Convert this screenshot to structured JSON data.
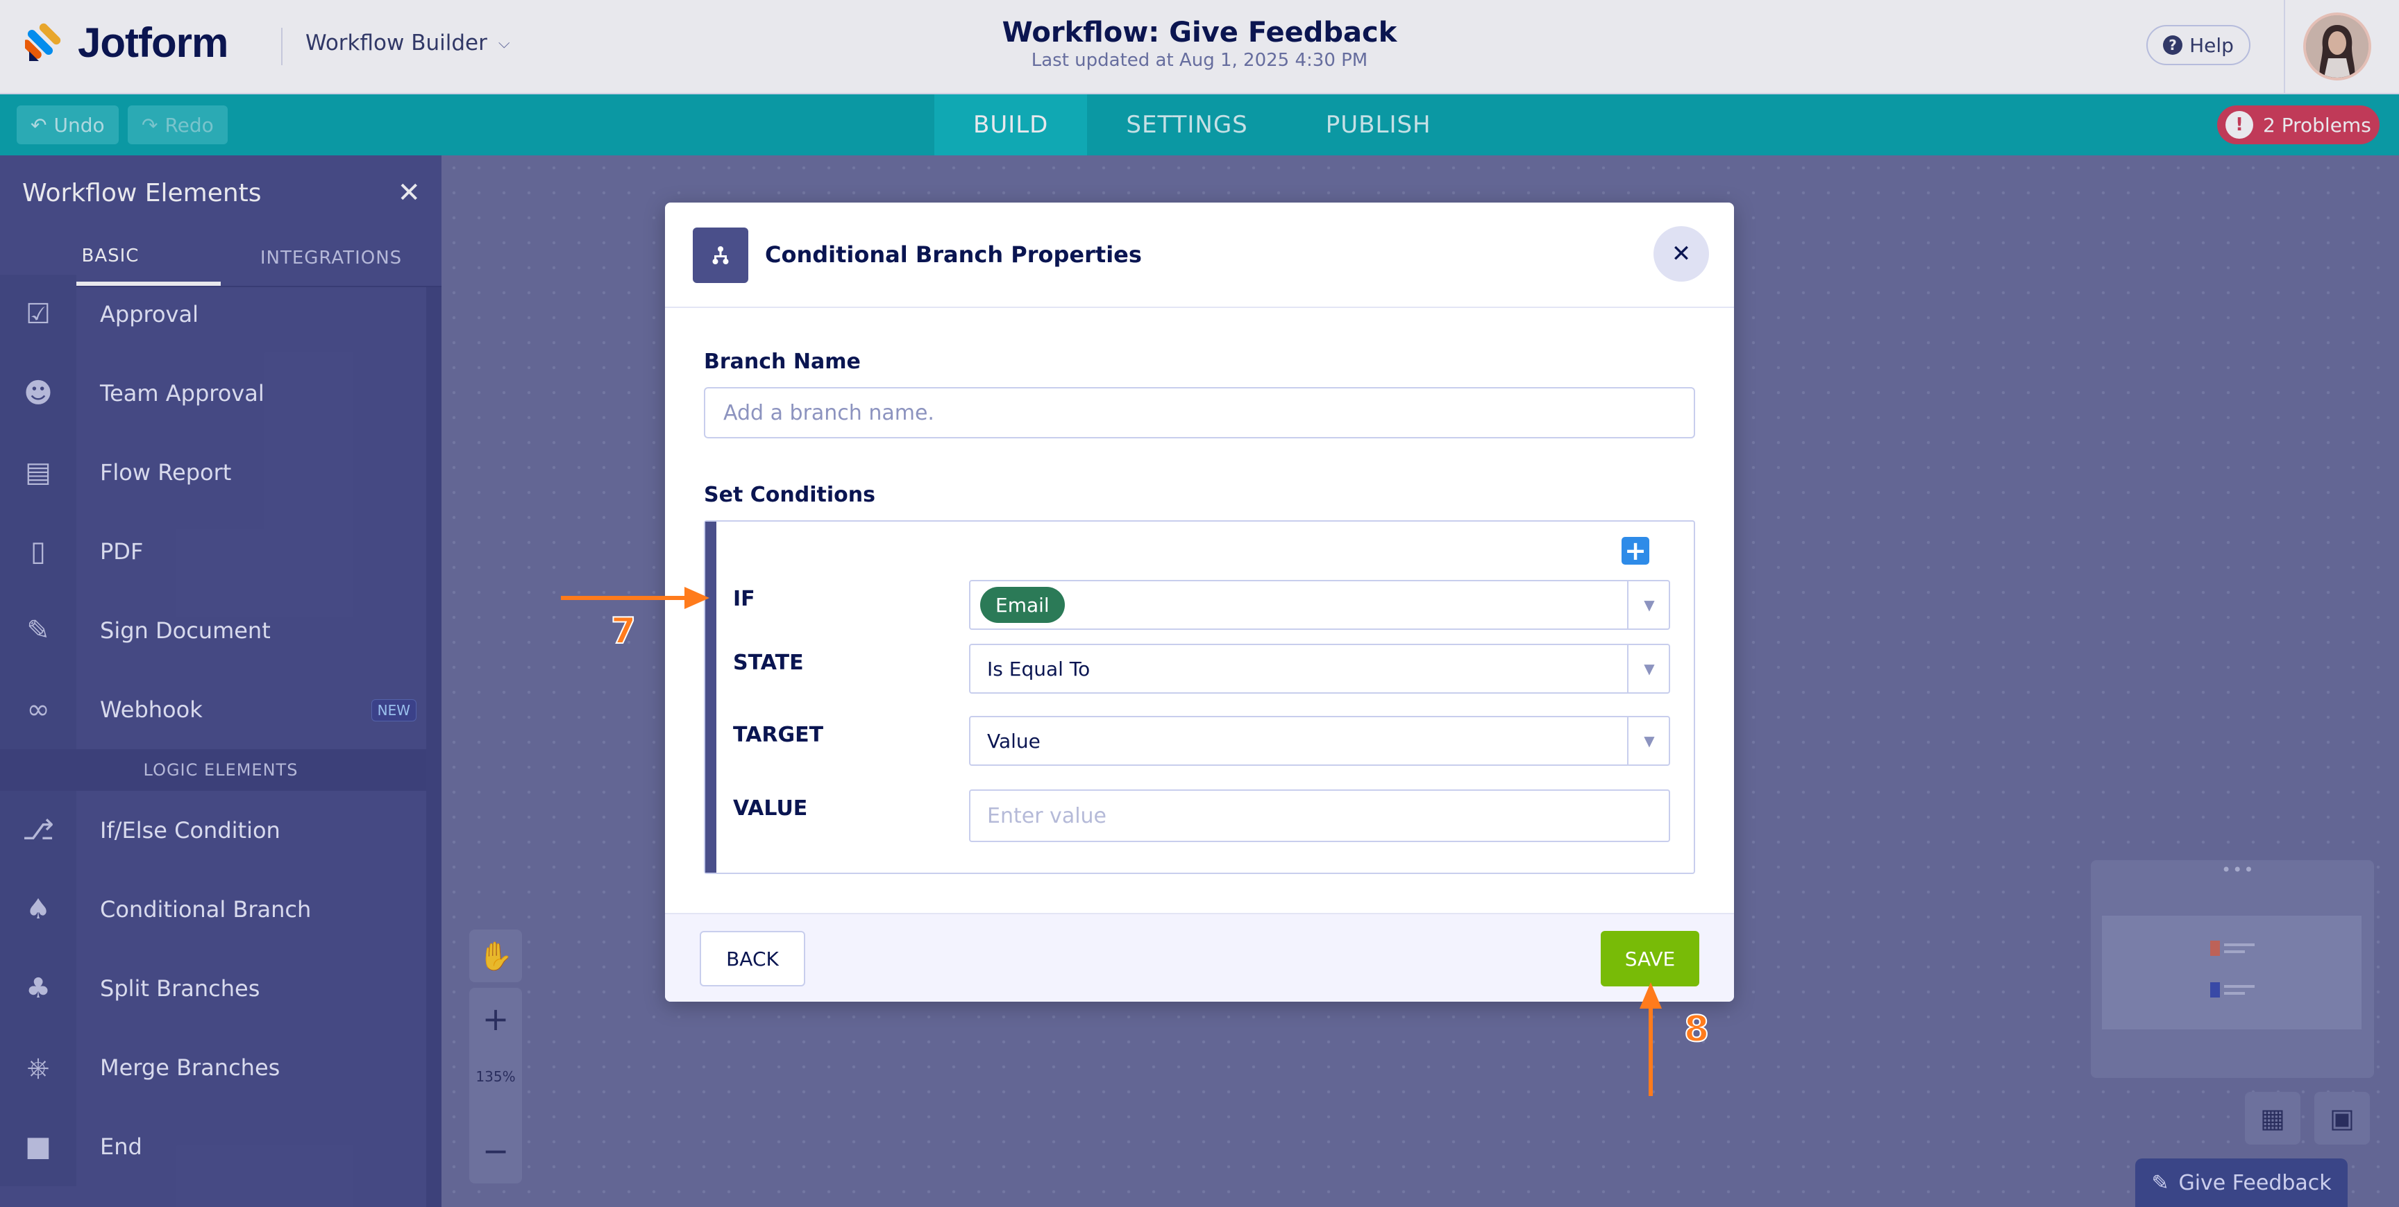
{
  "app": {
    "brand": "Jotform",
    "context_menu": "Workflow Builder",
    "workflow_title": "Workflow: Give Feedback",
    "last_updated": "Last updated at Aug 1, 2025 4:30 PM",
    "help_label": "Help"
  },
  "toolbar": {
    "undo_label": "Undo",
    "redo_label": "Redo",
    "tabs": [
      {
        "label": "BUILD",
        "active": true
      },
      {
        "label": "SETTINGS",
        "active": false
      },
      {
        "label": "PUBLISH",
        "active": false
      }
    ],
    "problems_count": "!",
    "problems_label": "2 Problems"
  },
  "sidebar": {
    "title": "Workflow Elements",
    "tabs": [
      {
        "label": "BASIC",
        "active": true
      },
      {
        "label": "INTEGRATIONS",
        "active": false
      }
    ],
    "items": [
      {
        "label": "Approval",
        "icon": "approval-icon"
      },
      {
        "label": "Team Approval",
        "icon": "team-approval-icon"
      },
      {
        "label": "Flow Report",
        "icon": "report-icon"
      },
      {
        "label": "PDF",
        "icon": "pdf-icon"
      },
      {
        "label": "Sign Document",
        "icon": "sign-document-icon"
      },
      {
        "label": "Webhook",
        "icon": "webhook-icon",
        "badge": "NEW"
      }
    ],
    "logic_section": "LOGIC ELEMENTS",
    "logic_items": [
      {
        "label": "If/Else Condition",
        "icon": "if-else-icon"
      },
      {
        "label": "Conditional Branch",
        "icon": "conditional-branch-icon"
      },
      {
        "label": "Split Branches",
        "icon": "split-branches-icon"
      },
      {
        "label": "Merge Branches",
        "icon": "merge-branches-icon"
      },
      {
        "label": "End",
        "icon": "end-icon"
      }
    ]
  },
  "canvas": {
    "zoom_level": "135%",
    "give_feedback_label": "Give Feedback"
  },
  "modal": {
    "title": "Conditional Branch Properties",
    "branch_name_label": "Branch Name",
    "branch_name_placeholder": "Add a branch name.",
    "branch_name_value": "",
    "set_conditions_label": "Set Conditions",
    "condition": {
      "if_label": "IF",
      "if_value": "Email",
      "state_label": "STATE",
      "state_value": "Is Equal To",
      "target_label": "TARGET",
      "target_value": "Value",
      "value_label": "VALUE",
      "value_placeholder": "Enter value",
      "value_value": ""
    },
    "back_label": "BACK",
    "save_label": "SAVE"
  },
  "annotations": {
    "step_7": "7",
    "step_8": "8"
  },
  "colors": {
    "accent_teal": "#09a6ad",
    "sidebar": "#4a4f8a",
    "save_green": "#78bb07",
    "chip_green": "#2b7a57",
    "problems_red": "#d33e5a",
    "annotation_orange": "#ff7b1c"
  }
}
